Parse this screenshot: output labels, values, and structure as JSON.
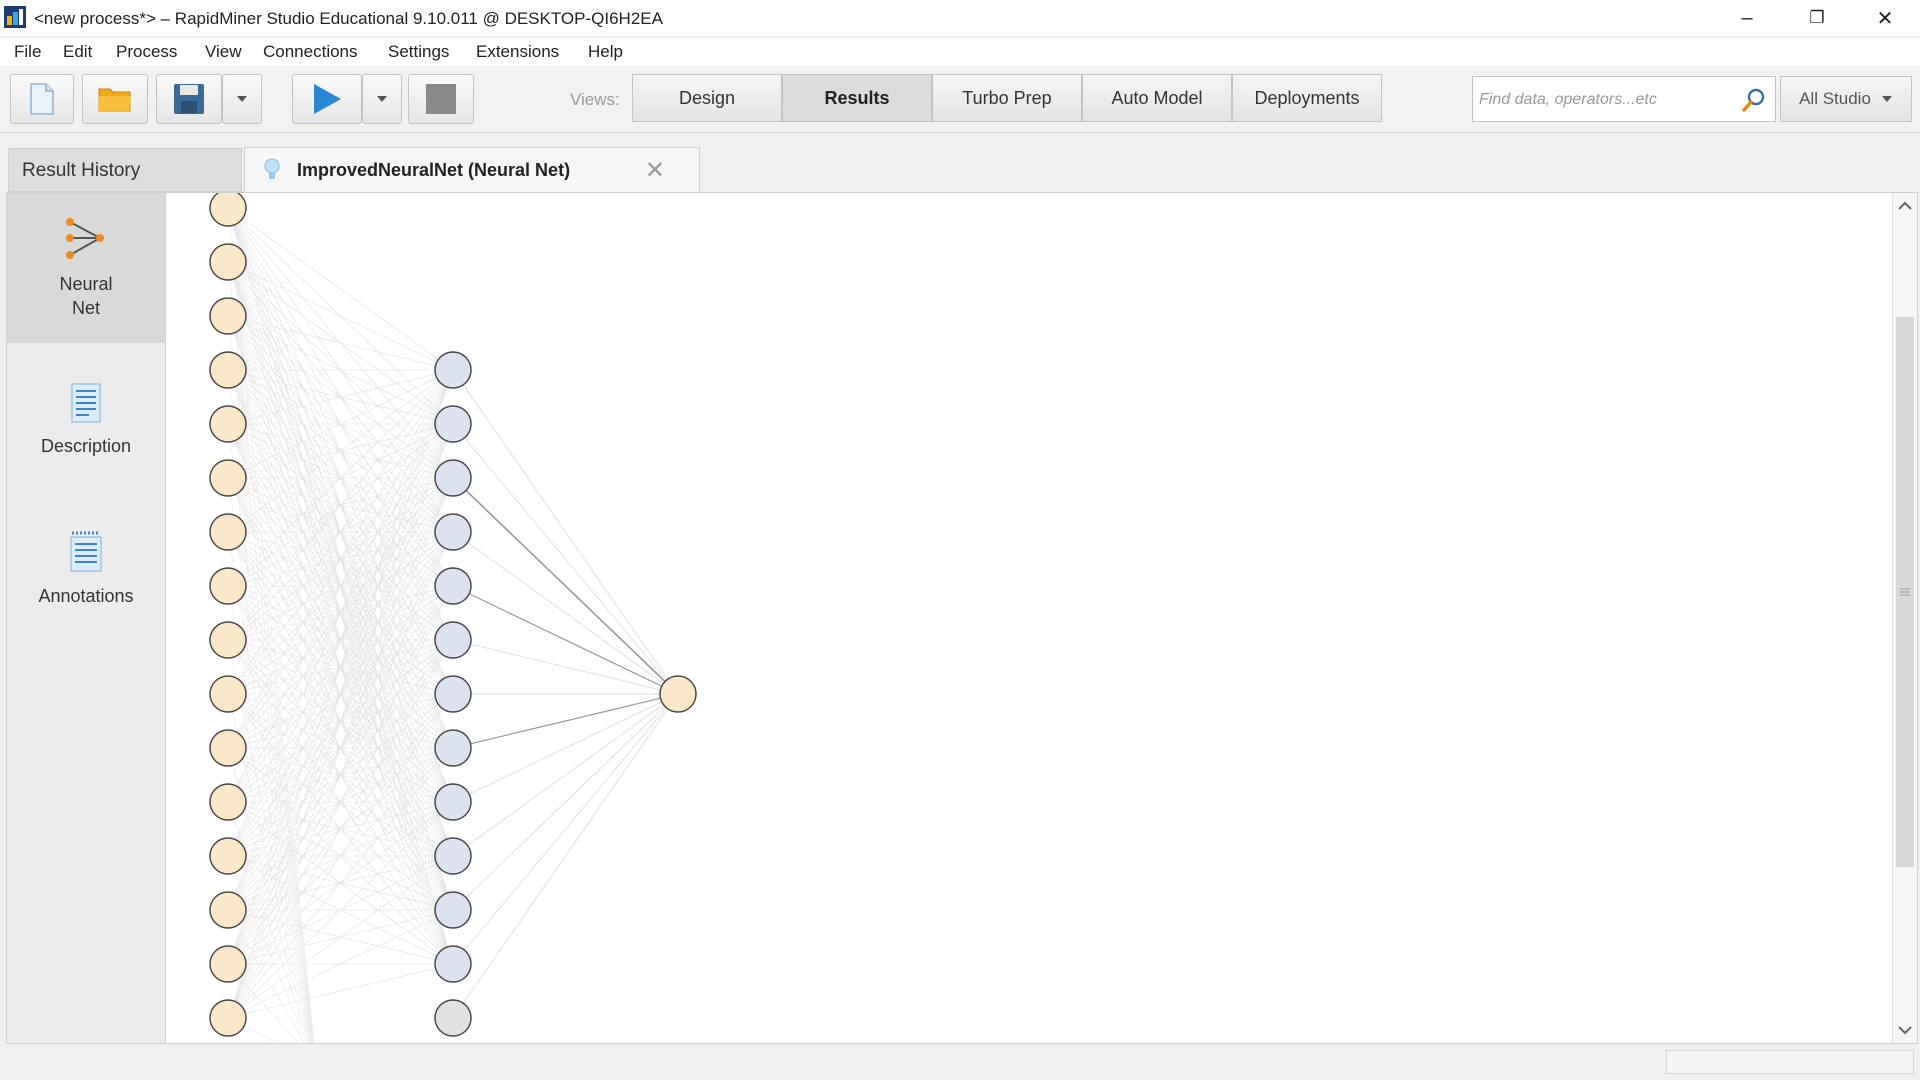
{
  "window": {
    "title": "<new process*> – RapidMiner Studio Educational 9.10.011 @ DESKTOP-QI6H2EA",
    "minimize": "–",
    "restore": "❐",
    "close": "✕"
  },
  "menu": [
    "File",
    "Edit",
    "Process",
    "View",
    "Connections",
    "Settings",
    "Extensions",
    "Help"
  ],
  "toolbar": {
    "views_label": "Views:",
    "views": [
      "Design",
      "Results",
      "Turbo Prep",
      "Auto Model",
      "Deployments"
    ],
    "active_view": "Results",
    "search_placeholder": "Find data, operators...etc",
    "studio_dropdown": "All Studio",
    "colors": {
      "play": "#2b86d6",
      "folder": "#f2a81d",
      "save": "#3a6a99"
    }
  },
  "tabs": {
    "history": "Result History",
    "active": "ImprovedNeuralNet (Neural Net)"
  },
  "sidebar": [
    {
      "label": "Neural Net",
      "icon": "neural-net-icon",
      "selected": true
    },
    {
      "label": "Description",
      "icon": "description-icon",
      "selected": false
    },
    {
      "label": "Annotations",
      "icon": "annotations-icon",
      "selected": false
    }
  ],
  "network": {
    "input_nodes_visible": 16,
    "hidden_nodes_visible": 13,
    "output_nodes": 1,
    "colors": {
      "input": "#fae8c8",
      "hidden": "#dde2f0",
      "bias": "#e2e2e2",
      "output": "#fae8c8",
      "stroke": "#4a4a4a"
    }
  }
}
